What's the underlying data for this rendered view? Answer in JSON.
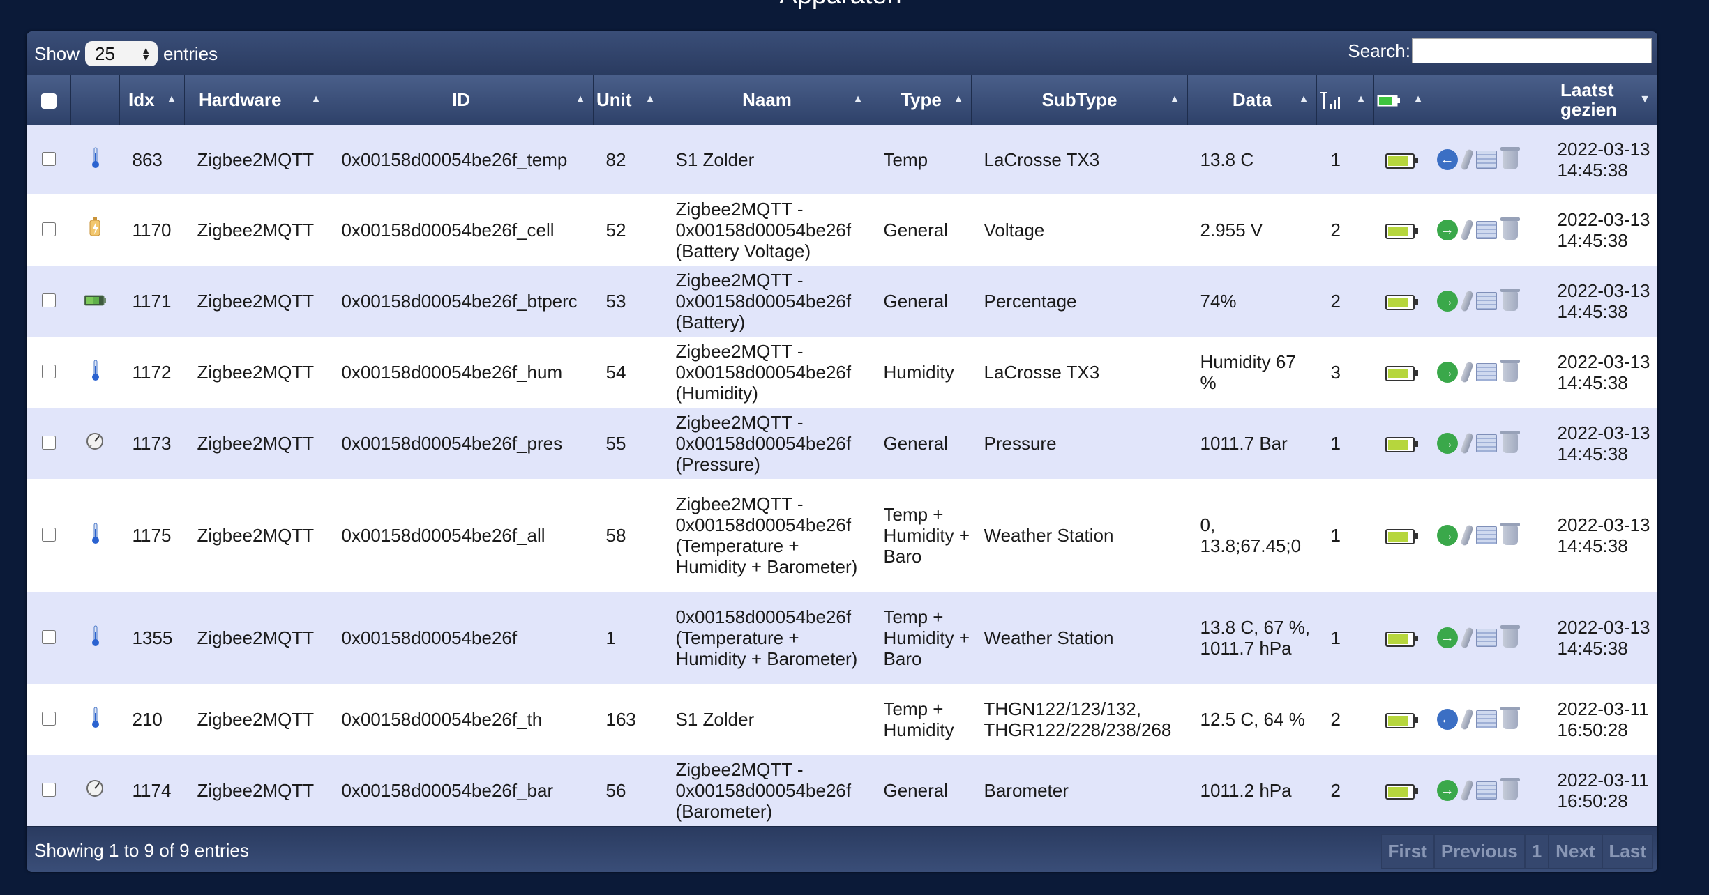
{
  "page": {
    "title": "Apparaten"
  },
  "toolbar": {
    "show_label": "Show",
    "entries_value": "25",
    "entries_label": "entries",
    "search_label": "Search:",
    "search_value": ""
  },
  "columns": {
    "idx": "Idx",
    "hardware": "Hardware",
    "id": "ID",
    "unit": "Unit",
    "naam": "Naam",
    "type": "Type",
    "subtype": "SubType",
    "data": "Data",
    "last_seen": "Laatst gezien"
  },
  "rows": [
    {
      "icon": "thermometer-icon",
      "idx": "863",
      "hardware": "Zigbee2MQTT",
      "id": "0x00158d00054be26f_temp",
      "unit": "82",
      "naam": "S1 Zolder",
      "type": "Temp",
      "subtype": "LaCrosse TX3",
      "data": "13.8 C",
      "signal": "1",
      "action": "blue",
      "last_seen": "2022-03-13 14:45:38"
    },
    {
      "icon": "voltage-icon",
      "idx": "1170",
      "hardware": "Zigbee2MQTT",
      "id": "0x00158d00054be26f_cell",
      "unit": "52",
      "naam": "Zigbee2MQTT - 0x00158d00054be26f (Battery Voltage)",
      "type": "General",
      "subtype": "Voltage",
      "data": "2.955 V",
      "signal": "2",
      "action": "green",
      "last_seen": "2022-03-13 14:45:38"
    },
    {
      "icon": "battery-level-icon",
      "idx": "1171",
      "hardware": "Zigbee2MQTT",
      "id": "0x00158d00054be26f_btperc",
      "unit": "53",
      "naam": "Zigbee2MQTT - 0x00158d00054be26f (Battery)",
      "type": "General",
      "subtype": "Percentage",
      "data": "74%",
      "signal": "2",
      "action": "green",
      "last_seen": "2022-03-13 14:45:38"
    },
    {
      "icon": "thermometer-icon",
      "idx": "1172",
      "hardware": "Zigbee2MQTT",
      "id": "0x00158d00054be26f_hum",
      "unit": "54",
      "naam": "Zigbee2MQTT - 0x00158d00054be26f (Humidity)",
      "type": "Humidity",
      "subtype": "LaCrosse TX3",
      "data": "Humidity 67 %",
      "signal": "3",
      "action": "green",
      "last_seen": "2022-03-13 14:45:38"
    },
    {
      "icon": "gauge-icon",
      "idx": "1173",
      "hardware": "Zigbee2MQTT",
      "id": "0x00158d00054be26f_pres",
      "unit": "55",
      "naam": "Zigbee2MQTT - 0x00158d00054be26f (Pressure)",
      "type": "General",
      "subtype": "Pressure",
      "data": "1011.7 Bar",
      "signal": "1",
      "action": "green",
      "last_seen": "2022-03-13 14:45:38"
    },
    {
      "icon": "thermometer-icon",
      "idx": "1175",
      "hardware": "Zigbee2MQTT",
      "id": "0x00158d00054be26f_all",
      "unit": "58",
      "naam": "Zigbee2MQTT - 0x00158d00054be26f (Temperature + Humidity + Barometer)",
      "type": "Temp + Humidity + Baro",
      "subtype": "Weather Station",
      "data": "0, 13.8;67.45;0",
      "signal": "1",
      "action": "green",
      "last_seen": "2022-03-13 14:45:38"
    },
    {
      "icon": "thermometer-icon",
      "idx": "1355",
      "hardware": "Zigbee2MQTT",
      "id": "0x00158d00054be26f",
      "unit": "1",
      "naam": "0x00158d00054be26f (Temperature + Humidity + Barometer)",
      "type": "Temp + Humidity + Baro",
      "subtype": "Weather Station",
      "data": "13.8 C, 67 %, 1011.7 hPa",
      "signal": "1",
      "action": "green",
      "last_seen": "2022-03-13 14:45:38"
    },
    {
      "icon": "thermometer-icon",
      "idx": "210",
      "hardware": "Zigbee2MQTT",
      "id": "0x00158d00054be26f_th",
      "unit": "163",
      "naam": "S1 Zolder",
      "type": "Temp + Humidity",
      "subtype": "THGN122/123/132, THGR122/228/238/268",
      "data": "12.5 C, 64 %",
      "signal": "2",
      "action": "blue",
      "last_seen": "2022-03-11 16:50:28"
    },
    {
      "icon": "gauge-icon",
      "idx": "1174",
      "hardware": "Zigbee2MQTT",
      "id": "0x00158d00054be26f_bar",
      "unit": "56",
      "naam": "Zigbee2MQTT - 0x00158d00054be26f (Barometer)",
      "type": "General",
      "subtype": "Barometer",
      "data": "1011.2 hPa",
      "signal": "2",
      "action": "green",
      "last_seen": "2022-03-11 16:50:28"
    }
  ],
  "footer": {
    "info": "Showing 1 to 9 of 9 entries",
    "pager": [
      "First",
      "Previous",
      "1",
      "Next",
      "Last"
    ]
  }
}
